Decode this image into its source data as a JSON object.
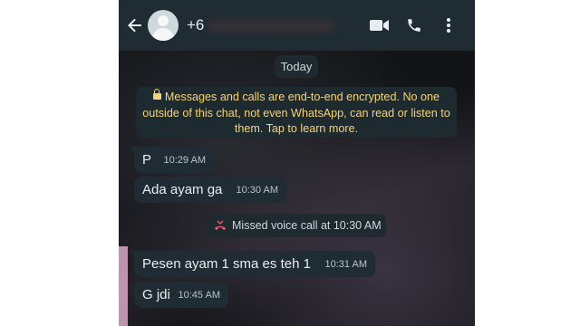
{
  "header": {
    "contact_name": "+6",
    "icons": [
      "back-arrow-icon",
      "avatar",
      "video-call-icon",
      "voice-call-icon",
      "more-options-icon"
    ]
  },
  "chat": {
    "date_label": "Today",
    "encryption_notice": "Messages and calls are end-to-end encrypted. No one outside of this chat, not even WhatsApp, can read or listen to them. Tap to learn more.",
    "messages": [
      {
        "text": "P",
        "time": "10:29 AM"
      },
      {
        "text": "Ada ayam ga",
        "time": "10:30 AM"
      },
      {
        "text": "Pesen ayam 1 sma es teh 1",
        "time": "10:31 AM"
      },
      {
        "text": "G jdi",
        "time": "10:45 AM"
      }
    ],
    "missed_call": "Missed voice call at 10:30 AM"
  },
  "colors": {
    "appbar": "#1f2c34",
    "bubble": "#1f2c34",
    "encryption_text": "#f6d37a",
    "missed_call_icon": "#f15c6d"
  }
}
